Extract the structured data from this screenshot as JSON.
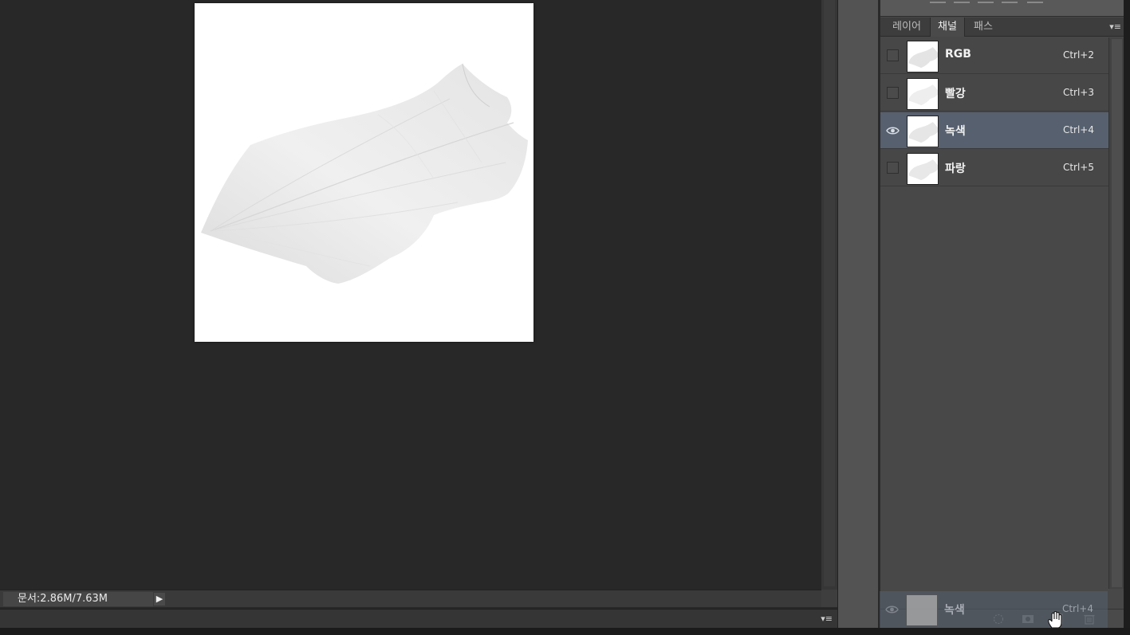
{
  "status": {
    "doc_info": "문서:2.86M/7.63M",
    "arrow": "▶"
  },
  "panel": {
    "tabs": [
      {
        "label": "레이어",
        "active": false
      },
      {
        "label": "채널",
        "active": true
      },
      {
        "label": "패스",
        "active": false
      }
    ],
    "menu_icon": "▾≡",
    "channels": [
      {
        "name": "RGB",
        "shortcut": "Ctrl+2",
        "visible": false,
        "selected": false
      },
      {
        "name": "빨강",
        "shortcut": "Ctrl+3",
        "visible": false,
        "selected": false
      },
      {
        "name": "녹색",
        "shortcut": "Ctrl+4",
        "visible": true,
        "selected": true
      },
      {
        "name": "파랑",
        "shortcut": "Ctrl+5",
        "visible": false,
        "selected": false
      }
    ],
    "drag_ghost": {
      "name": "녹색",
      "shortcut": "Ctrl+4"
    },
    "footer_icons": [
      "dotted-circle-icon",
      "mask-icon",
      "new-channel-icon",
      "trash-icon"
    ]
  },
  "bottom": {
    "menu_icon": "▾≡"
  },
  "colors": {
    "selected_row": "#56606f",
    "workspace": "#282828",
    "panel": "#484848"
  }
}
